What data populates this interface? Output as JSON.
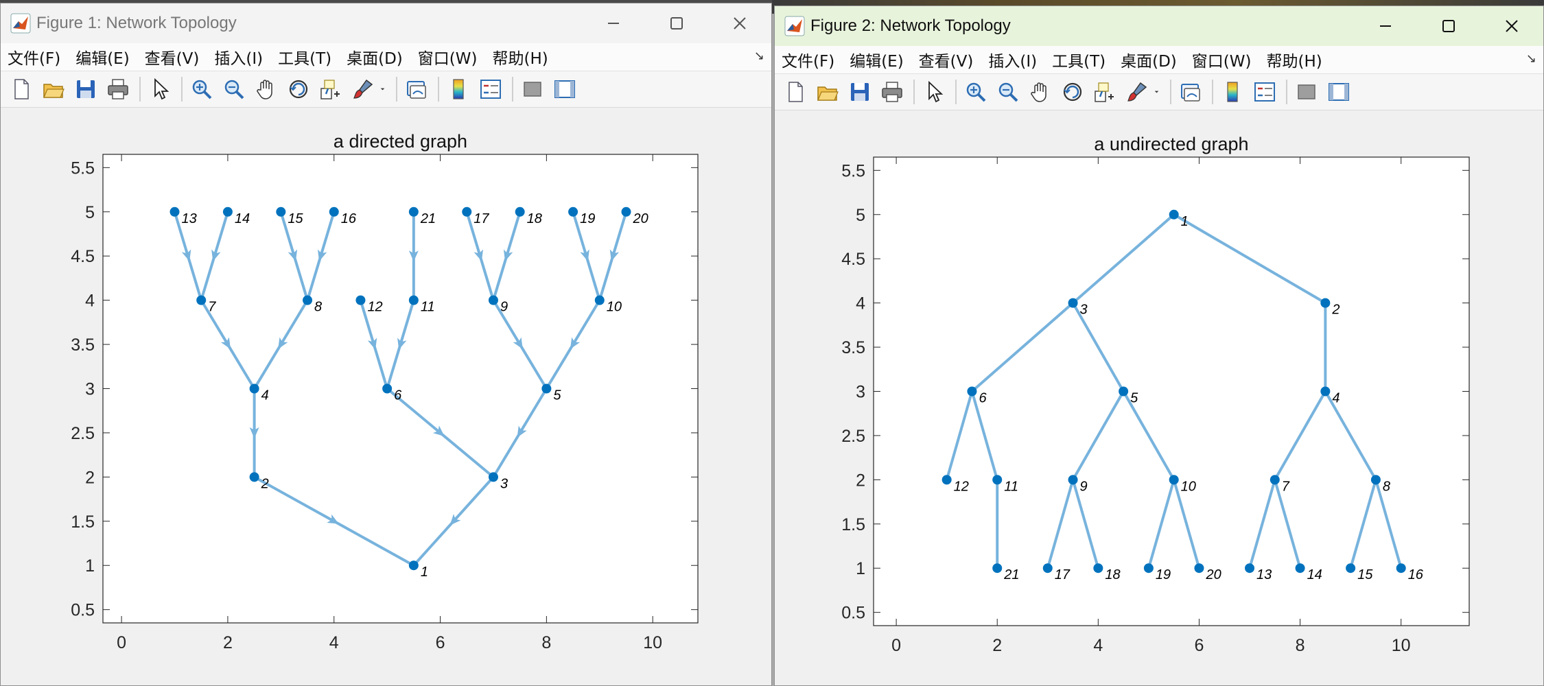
{
  "windows": [
    {
      "title": "Figure 1: Network Topology",
      "menu": [
        "文件(F)",
        "编辑(E)",
        "查看(V)",
        "插入(I)",
        "工具(T)",
        "桌面(D)",
        "窗口(W)",
        "帮助(H)"
      ],
      "toolbar": [
        "new-figure",
        "open-file",
        "save",
        "print",
        "select-pointer",
        "zoom-in",
        "zoom-out",
        "pan-hand",
        "rotate-3d",
        "data-cursor",
        "brush",
        "brush-dropdown",
        "link-plot",
        "colorbar",
        "legend",
        "hide-plot-tools",
        "show-plot-tools"
      ],
      "chart_data": {
        "type": "scatter",
        "title": "a directed  graph",
        "directed": true,
        "xlim": [
          -0.35,
          10.85
        ],
        "ylim": [
          0.35,
          5.65
        ],
        "xticks": [
          "0",
          "2",
          "4",
          "6",
          "8",
          "10"
        ],
        "yticks": [
          "0.5",
          "1",
          "1.5",
          "2",
          "2.5",
          "3",
          "3.5",
          "4",
          "4.5",
          "5",
          "5.5"
        ],
        "edge_color": "#77b3dd",
        "node_color": "#0072bd",
        "nodes": [
          {
            "id": "1",
            "x": 5.5,
            "y": 1
          },
          {
            "id": "2",
            "x": 2.5,
            "y": 2
          },
          {
            "id": "3",
            "x": 7,
            "y": 2
          },
          {
            "id": "4",
            "x": 2.5,
            "y": 3
          },
          {
            "id": "5",
            "x": 8,
            "y": 3
          },
          {
            "id": "6",
            "x": 5,
            "y": 3
          },
          {
            "id": "7",
            "x": 1.5,
            "y": 4
          },
          {
            "id": "8",
            "x": 3.5,
            "y": 4
          },
          {
            "id": "9",
            "x": 7,
            "y": 4
          },
          {
            "id": "10",
            "x": 9,
            "y": 4
          },
          {
            "id": "11",
            "x": 5.5,
            "y": 4
          },
          {
            "id": "12",
            "x": 4.5,
            "y": 4
          },
          {
            "id": "13",
            "x": 1,
            "y": 5
          },
          {
            "id": "14",
            "x": 2,
            "y": 5
          },
          {
            "id": "15",
            "x": 3,
            "y": 5
          },
          {
            "id": "16",
            "x": 4,
            "y": 5
          },
          {
            "id": "17",
            "x": 6.5,
            "y": 5
          },
          {
            "id": "18",
            "x": 7.5,
            "y": 5
          },
          {
            "id": "19",
            "x": 8.5,
            "y": 5
          },
          {
            "id": "20",
            "x": 9.5,
            "y": 5
          },
          {
            "id": "21",
            "x": 5.5,
            "y": 5
          }
        ],
        "edges": [
          [
            "13",
            "7"
          ],
          [
            "14",
            "7"
          ],
          [
            "15",
            "8"
          ],
          [
            "16",
            "8"
          ],
          [
            "7",
            "4"
          ],
          [
            "8",
            "4"
          ],
          [
            "4",
            "2"
          ],
          [
            "2",
            "1"
          ],
          [
            "12",
            "6"
          ],
          [
            "11",
            "6"
          ],
          [
            "21",
            "11"
          ],
          [
            "6",
            "3"
          ],
          [
            "17",
            "9"
          ],
          [
            "18",
            "9"
          ],
          [
            "19",
            "10"
          ],
          [
            "20",
            "10"
          ],
          [
            "9",
            "5"
          ],
          [
            "10",
            "5"
          ],
          [
            "5",
            "3"
          ],
          [
            "3",
            "1"
          ]
        ]
      }
    },
    {
      "title": "Figure 2: Network Topology",
      "menu": [
        "文件(F)",
        "编辑(E)",
        "查看(V)",
        "插入(I)",
        "工具(T)",
        "桌面(D)",
        "窗口(W)",
        "帮助(H)"
      ],
      "toolbar": [
        "new-figure",
        "open-file",
        "save",
        "print",
        "select-pointer",
        "zoom-in",
        "zoom-out",
        "pan-hand",
        "rotate-3d",
        "data-cursor",
        "brush",
        "brush-dropdown",
        "link-plot",
        "colorbar",
        "legend",
        "hide-plot-tools",
        "show-plot-tools"
      ],
      "chart_data": {
        "type": "scatter",
        "title": "a undirected  graph",
        "directed": false,
        "xlim": [
          -0.45,
          11.35
        ],
        "ylim": [
          0.35,
          5.65
        ],
        "xticks": [
          "0",
          "2",
          "4",
          "6",
          "8",
          "10"
        ],
        "yticks": [
          "0.5",
          "1",
          "1.5",
          "2",
          "2.5",
          "3",
          "3.5",
          "4",
          "4.5",
          "5",
          "5.5"
        ],
        "edge_color": "#77b3dd",
        "node_color": "#0072bd",
        "nodes": [
          {
            "id": "1",
            "x": 5.5,
            "y": 5
          },
          {
            "id": "2",
            "x": 8.5,
            "y": 4
          },
          {
            "id": "3",
            "x": 3.5,
            "y": 4
          },
          {
            "id": "4",
            "x": 8.5,
            "y": 3
          },
          {
            "id": "5",
            "x": 4.5,
            "y": 3
          },
          {
            "id": "6",
            "x": 1.5,
            "y": 3
          },
          {
            "id": "7",
            "x": 7.5,
            "y": 2
          },
          {
            "id": "8",
            "x": 9.5,
            "y": 2
          },
          {
            "id": "9",
            "x": 3.5,
            "y": 2
          },
          {
            "id": "10",
            "x": 5.5,
            "y": 2
          },
          {
            "id": "11",
            "x": 2,
            "y": 2
          },
          {
            "id": "12",
            "x": 1,
            "y": 2
          },
          {
            "id": "13",
            "x": 7,
            "y": 1
          },
          {
            "id": "14",
            "x": 8,
            "y": 1
          },
          {
            "id": "15",
            "x": 9,
            "y": 1
          },
          {
            "id": "16",
            "x": 10,
            "y": 1
          },
          {
            "id": "17",
            "x": 3,
            "y": 1
          },
          {
            "id": "18",
            "x": 4,
            "y": 1
          },
          {
            "id": "19",
            "x": 5,
            "y": 1
          },
          {
            "id": "20",
            "x": 6,
            "y": 1
          },
          {
            "id": "21",
            "x": 2,
            "y": 1
          }
        ],
        "edges": [
          [
            "1",
            "3"
          ],
          [
            "1",
            "2"
          ],
          [
            "3",
            "6"
          ],
          [
            "3",
            "5"
          ],
          [
            "2",
            "4"
          ],
          [
            "6",
            "12"
          ],
          [
            "6",
            "11"
          ],
          [
            "11",
            "21"
          ],
          [
            "5",
            "9"
          ],
          [
            "5",
            "10"
          ],
          [
            "9",
            "17"
          ],
          [
            "9",
            "18"
          ],
          [
            "10",
            "19"
          ],
          [
            "10",
            "20"
          ],
          [
            "4",
            "7"
          ],
          [
            "4",
            "8"
          ],
          [
            "7",
            "13"
          ],
          [
            "7",
            "14"
          ],
          [
            "8",
            "15"
          ],
          [
            "8",
            "16"
          ]
        ]
      }
    }
  ]
}
